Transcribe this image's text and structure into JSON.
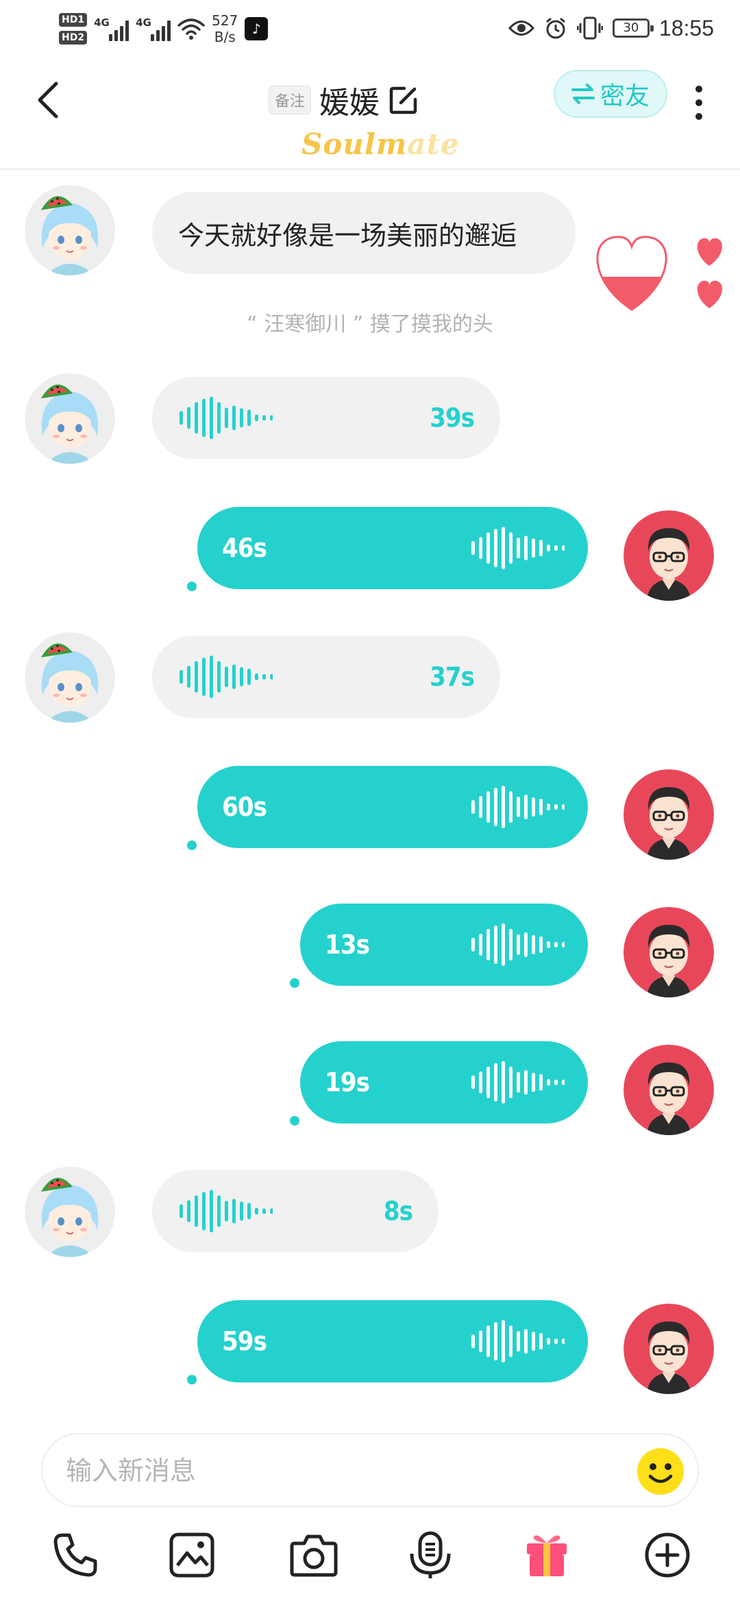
{
  "status_bar": {
    "hd1": "HD1",
    "hd2": "HD2",
    "net1": "4G",
    "net2": "4G",
    "speed_value": "527",
    "speed_unit": "B/s",
    "battery": "30",
    "time": "18:55"
  },
  "header": {
    "remark_label": "备注",
    "contact_name": "媛媛",
    "close_friend_label": "密友",
    "brand_bright": "Soulm",
    "brand_faded": "ate"
  },
  "messages": [
    {
      "side": "in",
      "type": "text",
      "text": "今天就好像是一场美丽的邂逅"
    },
    {
      "side": "system",
      "text": "“ 汪寒御川 ” 摸了摸我的头"
    },
    {
      "side": "in",
      "type": "voice",
      "duration": "39s"
    },
    {
      "side": "out",
      "type": "voice",
      "duration": "46s"
    },
    {
      "side": "in",
      "type": "voice",
      "duration": "37s"
    },
    {
      "side": "out",
      "type": "voice",
      "duration": "60s"
    },
    {
      "side": "out",
      "type": "voice",
      "duration": "13s"
    },
    {
      "side": "out",
      "type": "voice",
      "duration": "19s"
    },
    {
      "side": "in",
      "type": "voice",
      "duration": "8s"
    },
    {
      "side": "out",
      "type": "voice",
      "duration": "59s"
    }
  ],
  "input": {
    "placeholder": "输入新消息"
  },
  "toolbar": {
    "items": [
      "phone-icon",
      "image-icon",
      "camera-icon",
      "voice-icon",
      "gift-icon",
      "add-icon"
    ]
  },
  "colors": {
    "accent": "#25d1cd",
    "incoming_bubble": "#f1f1f1",
    "brand_gold": "#f6c548",
    "heart_red": "#f25b6a"
  }
}
